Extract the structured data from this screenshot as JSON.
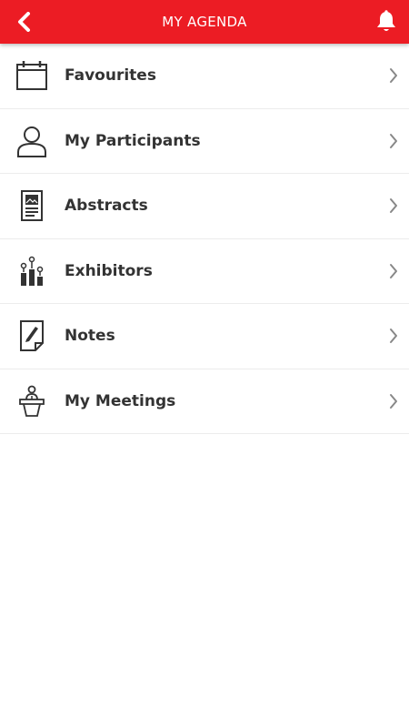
{
  "header": {
    "title": "MY AGENDA",
    "back_icon": "chevron-left-icon",
    "bell_icon": "bell-icon",
    "background_color": "#ec1c24"
  },
  "menu": {
    "items": [
      {
        "label": "Favourites",
        "icon": "calendar-icon"
      },
      {
        "label": "My Participants",
        "icon": "person-icon"
      },
      {
        "label": "Abstracts",
        "icon": "document-image-icon"
      },
      {
        "label": "Exhibitors",
        "icon": "map-pins-bars-icon"
      },
      {
        "label": "Notes",
        "icon": "note-pencil-icon"
      },
      {
        "label": "My Meetings",
        "icon": "podium-speaker-icon"
      }
    ]
  }
}
